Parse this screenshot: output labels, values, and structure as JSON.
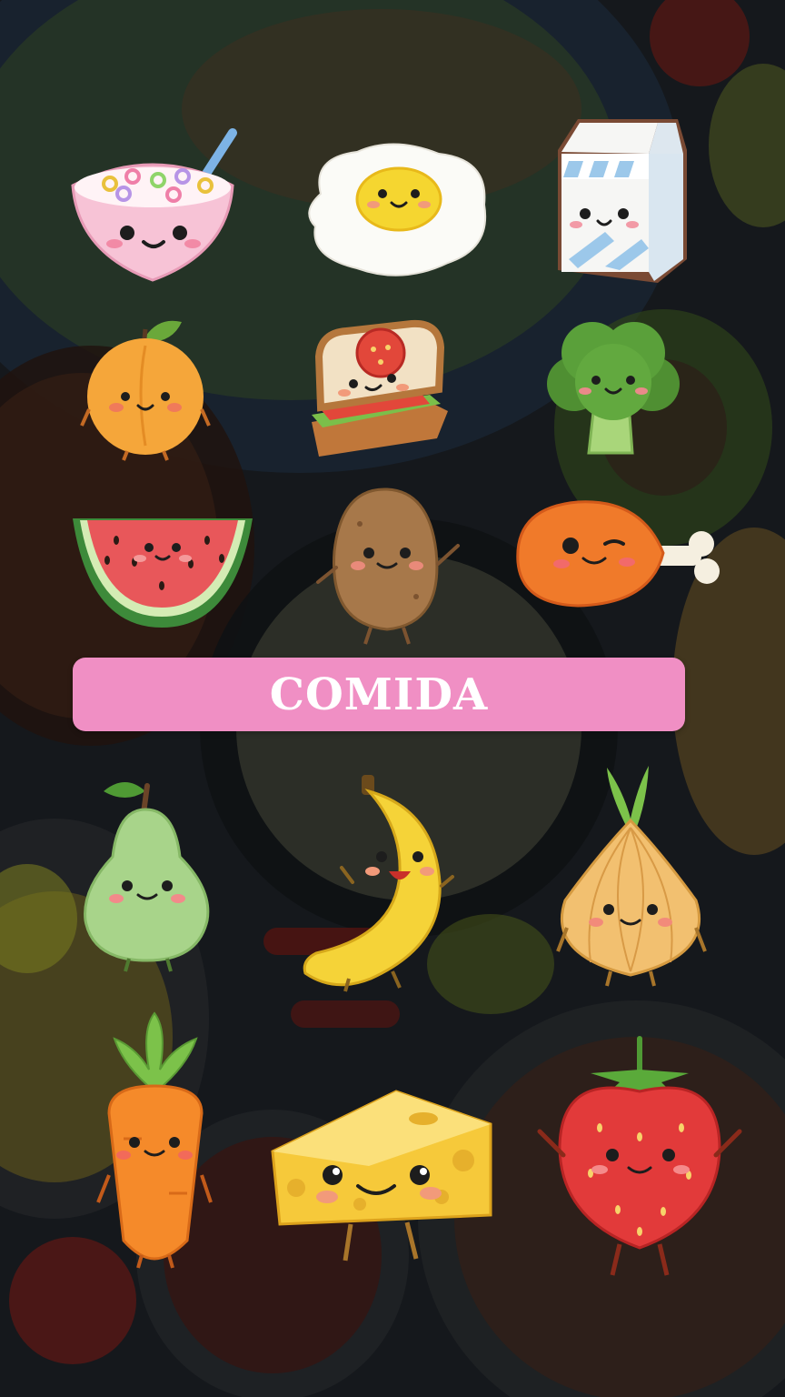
{
  "banner": {
    "title": "COMIDA"
  },
  "colors": {
    "banner_bg": "#f08fc4",
    "banner_text": "#ffffff",
    "background": "#1a1d22"
  },
  "stickers": [
    {
      "icon": "cereal-bowl-icon"
    },
    {
      "icon": "fried-egg-icon"
    },
    {
      "icon": "milk-carton-icon"
    },
    {
      "icon": "peach-icon"
    },
    {
      "icon": "sandwich-icon"
    },
    {
      "icon": "broccoli-icon"
    },
    {
      "icon": "watermelon-slice-icon"
    },
    {
      "icon": "potato-icon"
    },
    {
      "icon": "chicken-drumstick-icon"
    },
    {
      "icon": "pear-icon"
    },
    {
      "icon": "banana-icon"
    },
    {
      "icon": "onion-icon"
    },
    {
      "icon": "carrot-icon"
    },
    {
      "icon": "cheese-icon"
    },
    {
      "icon": "strawberry-icon"
    }
  ]
}
